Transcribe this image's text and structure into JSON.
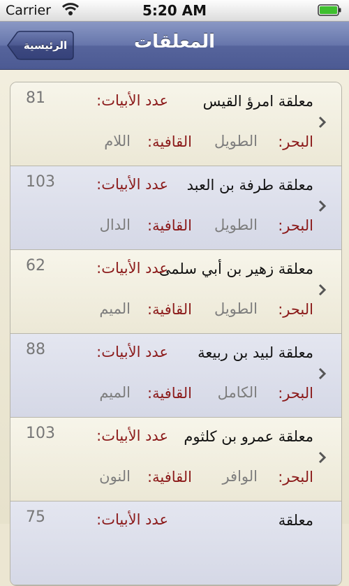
{
  "status_bar": {
    "carrier": "Carrier",
    "time": "5:20 AM"
  },
  "nav": {
    "title": "المعلقات",
    "back_label": "الرئيسية"
  },
  "labels": {
    "verse_count": "عدد الأبيات:",
    "meter": "البحر:",
    "rhyme": "القافية:"
  },
  "rows": [
    {
      "poem": "معلقة امرؤ القيس",
      "count": "81",
      "meter": "الطويل",
      "rhyme": "اللام"
    },
    {
      "poem": "معلقة طرفة بن العبد",
      "count": "103",
      "meter": "الطويل",
      "rhyme": "الدال"
    },
    {
      "poem": "معلقة زهير بن أبي سلمى",
      "count": "62",
      "meter": "الطويل",
      "rhyme": "الميم"
    },
    {
      "poem": "معلقة لبيد بن ربيعة",
      "count": "88",
      "meter": "الكامل",
      "rhyme": "الميم"
    },
    {
      "poem": "معلقة عمرو بن كلثوم",
      "count": "103",
      "meter": "الوافر",
      "rhyme": "النون"
    },
    {
      "poem": "معلقة",
      "count": "75",
      "meter": "",
      "rhyme": ""
    }
  ]
}
